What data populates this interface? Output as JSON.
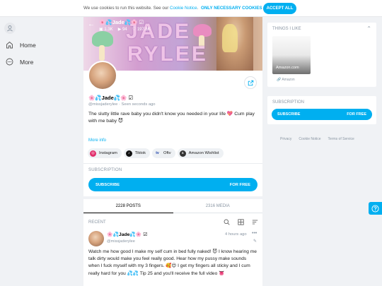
{
  "cookie": {
    "message": "We use cookies to run this website. See our",
    "link": "Cookie Notice",
    "link_suffix": ".",
    "necessary_label": "ONLY NECESSARY COOKIES",
    "accept_label": "ACCEPT ALL"
  },
  "nav": {
    "items": [
      {
        "label": "Home",
        "icon": "home-icon"
      },
      {
        "label": "More",
        "icon": "more-icon"
      }
    ]
  },
  "cover": {
    "name": "🌸💦Jade💦🌸 ☑",
    "stats": [
      "1.3K",
      "94",
      "197.8K"
    ],
    "art_text_1": "JADE",
    "art_text_2": "RYLEE"
  },
  "profile": {
    "name": "🌸💦Jade💦🌸 ☑",
    "handle": "@missjaderylee",
    "seen": "Seen  seconds ago",
    "bio": "The slutty little rave baby you didn't know you needed in your life 💖 Cum play with me baby 😈",
    "more_info": "More info",
    "links": [
      {
        "label": "Instagram",
        "color": "#e1306c",
        "icon": "instagram-icon"
      },
      {
        "label": "Tiktok",
        "color": "#111111",
        "icon": "tiktok-icon"
      },
      {
        "label": "Oftv",
        "color": "#1a3fa8",
        "icon": "oftv-icon"
      },
      {
        "label": "Amazon Wishlist",
        "color": "#333333",
        "icon": "amazon-icon"
      }
    ]
  },
  "subscription": {
    "title": "SUBSCRIPTION",
    "button": "SUBSCRIBE",
    "price": "FOR FREE"
  },
  "tabs": [
    {
      "label": "2228 POSTS",
      "active": true
    },
    {
      "label": "2316 MEDIA",
      "active": false
    }
  ],
  "recent": {
    "label": "RECENT"
  },
  "post": {
    "name": "🌸💦Jade💦🌸 ☑",
    "handle": "@missjaderylee",
    "time": "4 hours ago",
    "menu": "•••",
    "text": "Watch me how good I make my self cum in bed fully naked! 😈 I know hearing me talk dirty would make you feel really good. Hear how my pussy make sounds when I fuck myself with my 3 fingers. 🥰😍 I get my fingers all sticky and I cum really hard for you 💦💦 Tip 25 and you'll receive the full video 👅"
  },
  "sidebar": {
    "things_title": "THINGS I LIKE",
    "tile_caption": "Amazon.com",
    "tile_source": "Amazon",
    "subscription_title": "SUBSCRIPTION",
    "subscribe_label": "SUBSCRIBE",
    "subscribe_price": "FOR FREE"
  },
  "footer": {
    "links": [
      "Privacy",
      "Cookie Notice",
      "Terms of Service"
    ]
  },
  "colors": {
    "accent": "#00aff0",
    "muted": "#8a96a3",
    "background": "#f0f2f5"
  }
}
